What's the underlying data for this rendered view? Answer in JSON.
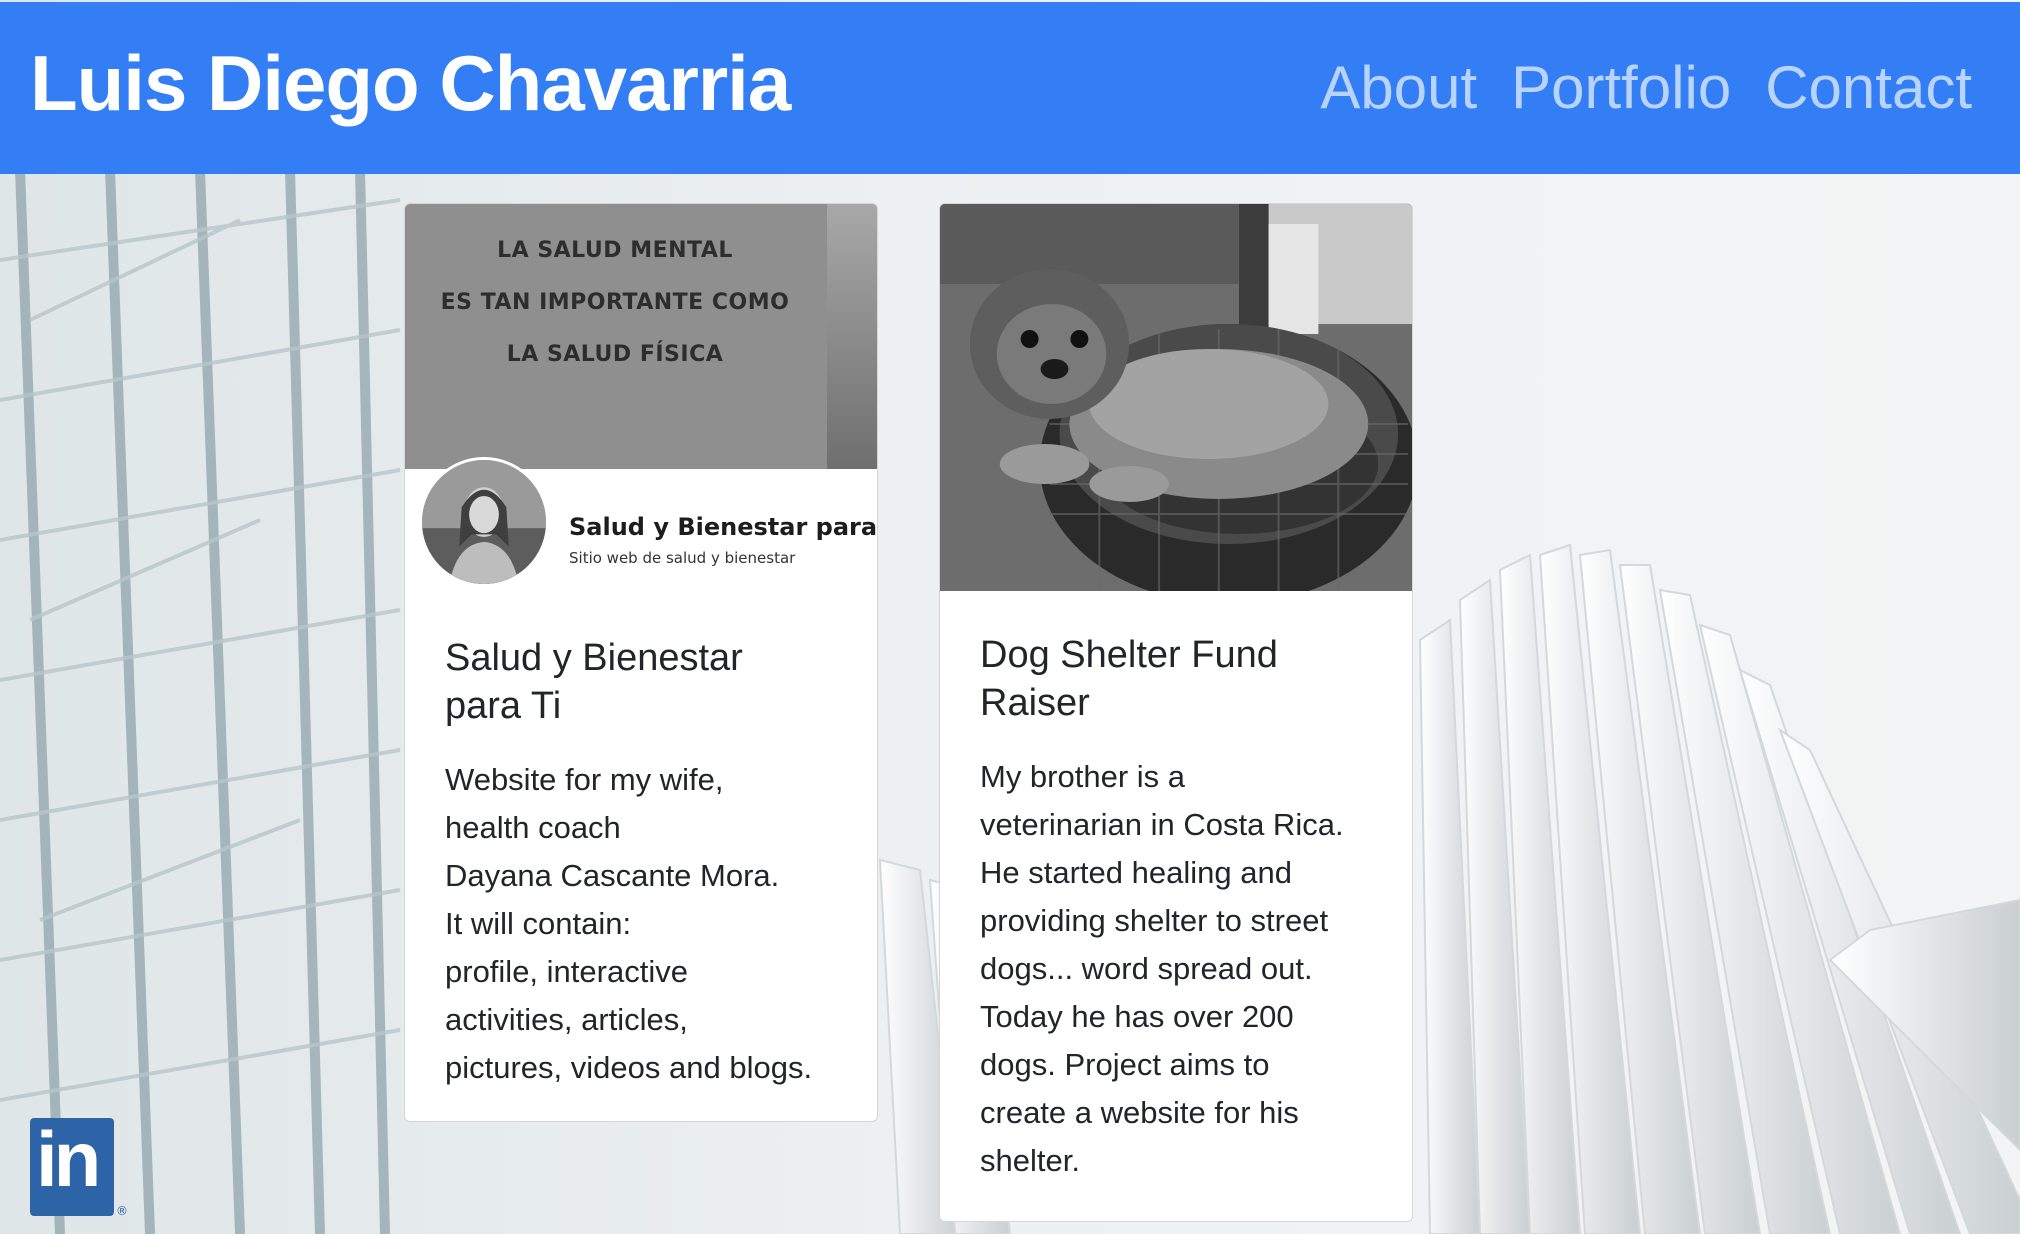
{
  "header": {
    "brand": "Luis Diego Chavarria",
    "nav": [
      "About",
      "Portfolio",
      "Contact"
    ]
  },
  "cards": [
    {
      "image": {
        "quote": [
          "LA SALUD MENTAL",
          "ES TAN IMPORTANTE COMO",
          "LA SALUD FÍSICA"
        ],
        "profile_name": "Salud y Bienestar para ti",
        "profile_subtitle": "Sitio web de salud y bienestar"
      },
      "title": "Salud y Bienestar\npara Ti",
      "text": "Website for my wife,\nhealth coach\nDayana Cascante Mora.\nIt will contain:\nprofile, interactive\nactivities, articles,\npictures, videos and blogs."
    },
    {
      "image": {
        "subject": "dog-in-basket-photo"
      },
      "title": "Dog Shelter Fund\nRaiser",
      "text": "My brother is a\nveterinarian in Costa Rica.\nHe started healing and\nproviding shelter to street\ndogs... word spread out.\nToday he has over 200\ndogs. Project aims to\ncreate a website for his\nshelter."
    }
  ],
  "footer": {
    "linkedin_icon": "linkedin-icon",
    "linkedin_text": "in",
    "linkedin_mark": "®"
  },
  "colors": {
    "navbar": "#337ef5",
    "nav_link": "#b9d3ff",
    "linkedin": "#2d64a8"
  }
}
